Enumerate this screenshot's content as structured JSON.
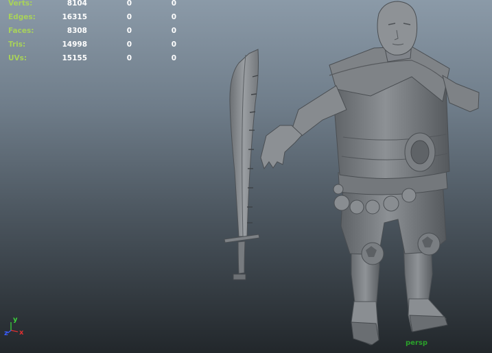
{
  "hud": {
    "rows": [
      {
        "label": "Verts:",
        "a": "8104",
        "b": "0",
        "c": "0"
      },
      {
        "label": "Edges:",
        "a": "16315",
        "b": "0",
        "c": "0"
      },
      {
        "label": "Faces:",
        "a": "8308",
        "b": "0",
        "c": "0"
      },
      {
        "label": "Tris:",
        "a": "14998",
        "b": "0",
        "c": "0"
      },
      {
        "label": "UVs:",
        "a": "15155",
        "b": "0",
        "c": "0"
      }
    ]
  },
  "axes": {
    "x": "x",
    "y": "y",
    "z": "z"
  },
  "camera": "persp",
  "colors": {
    "hud_label": "#a8d25a",
    "hud_value": "#ffffff",
    "camera_label": "#2aa12a",
    "axis_x": "#e03030",
    "axis_y": "#3cd23c",
    "axis_z": "#3a5cff"
  }
}
